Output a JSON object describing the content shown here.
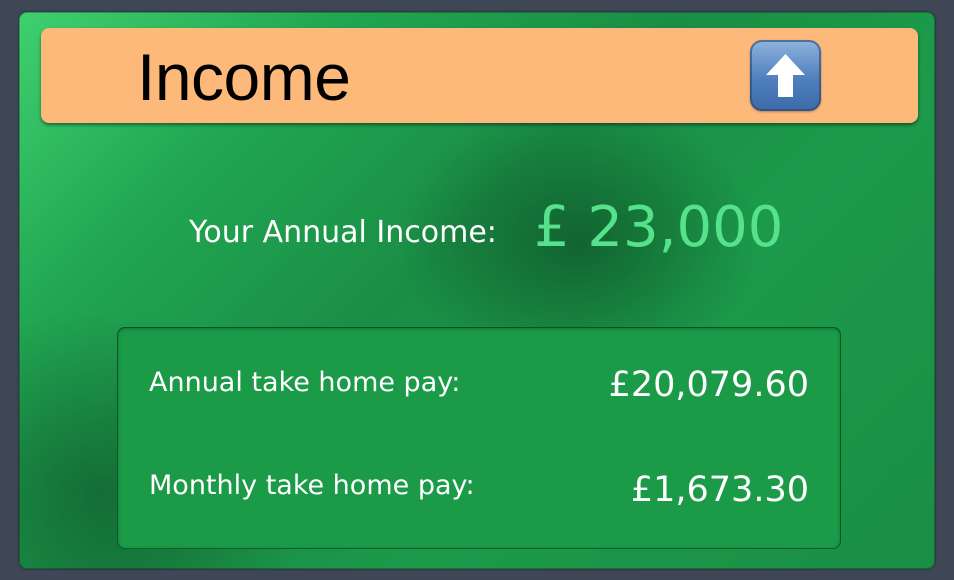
{
  "header": {
    "title": "Income",
    "collapse_icon": "up-arrow-icon"
  },
  "income": {
    "label": "Your Annual Income:",
    "value": "£ 23,000"
  },
  "take_home": {
    "annual_label": "Annual take home pay:",
    "annual_value": "£20,079.60",
    "monthly_label": "Monthly take home pay:",
    "monthly_value": "£1,673.30"
  },
  "colors": {
    "header_bg": "#fdb97a",
    "card_green": "#1b9a48",
    "income_value": "#55e28a"
  }
}
